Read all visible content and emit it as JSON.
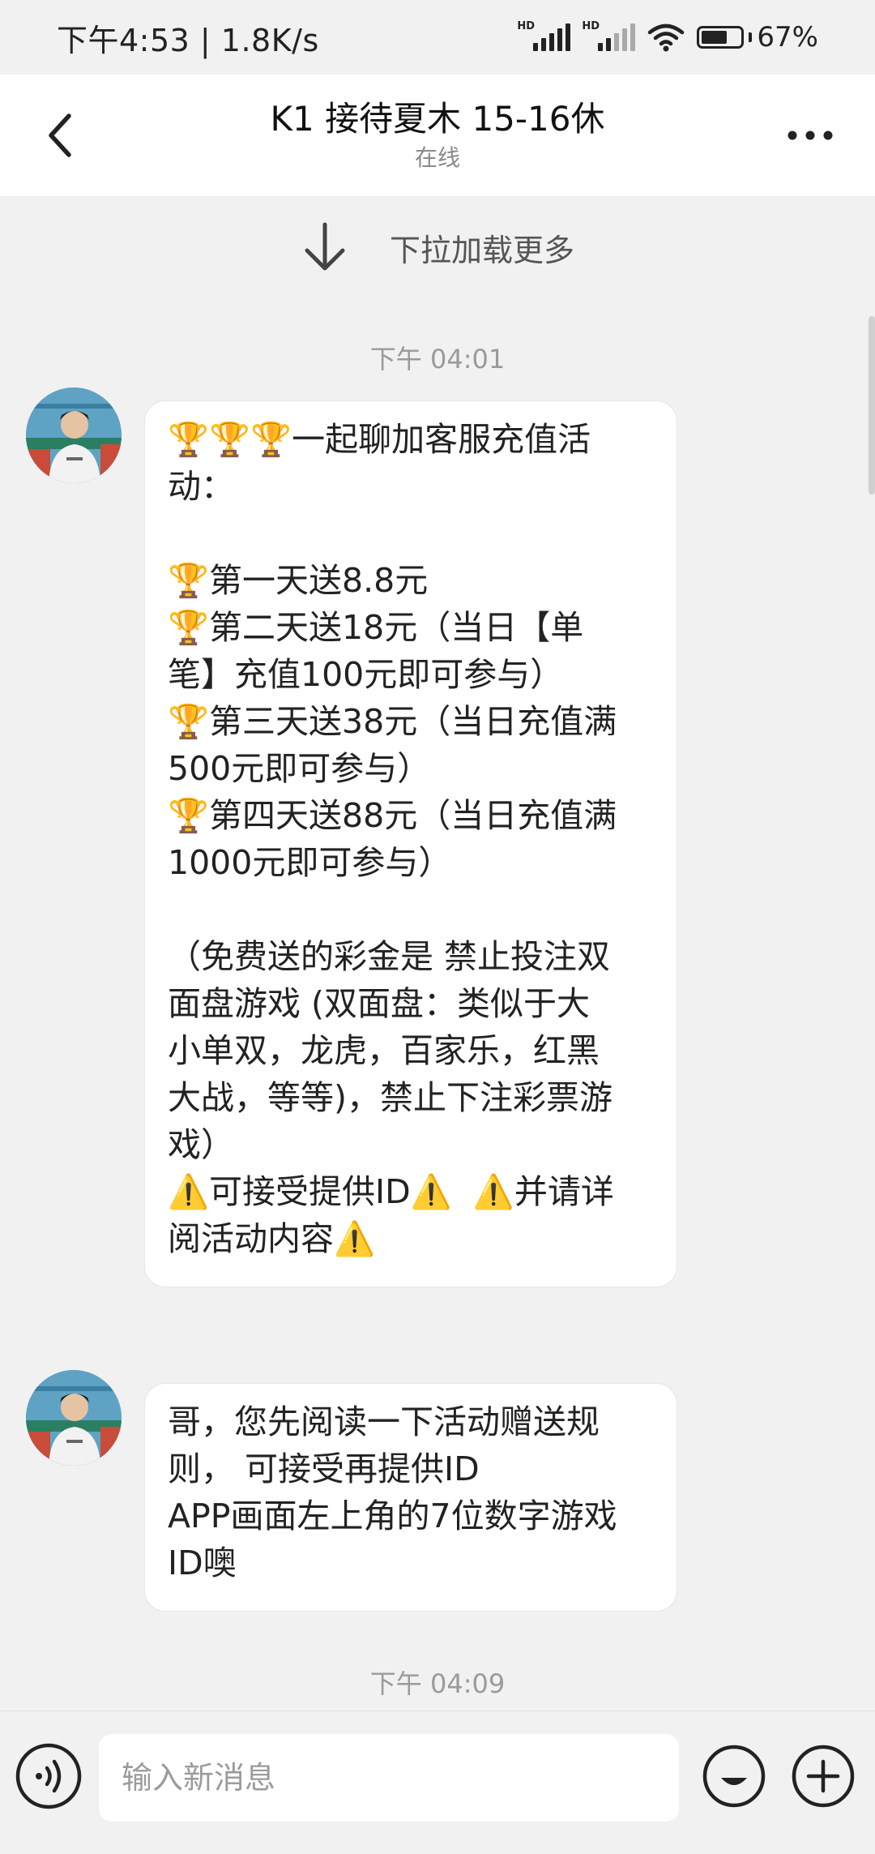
{
  "status_bar": {
    "time_speed": "下午4:53 | 1.8K/s",
    "signal1_label": "HD",
    "signal2_label": "HD",
    "battery_text": "67%",
    "battery_level": 0.67
  },
  "header": {
    "title": "K1 接待夏木 15-16休",
    "subtitle": "在线"
  },
  "pull_to_load": "下拉加载更多",
  "messages": [
    {
      "timestamp": "下午 04:01",
      "lines": [
        "🏆🏆🏆一起聊加客服充值活",
        "动：",
        "",
        "🏆第一天送8.8元",
        "🏆第二天送18元（当日【单",
        "笔】充值100元即可参与）",
        "🏆第三天送38元（当日充值满",
        "500元即可参与）",
        "🏆第四天送88元（当日充值满",
        "1000元即可参与）",
        "",
        "（免费送的彩金是 禁止投注双",
        "面盘游戏 (双面盘：类似于大",
        "小单双，龙虎，百家乐，红黑",
        "大战，等等)，禁止下注彩票游",
        "戏）",
        "⚠️可接受提供ID⚠️  ⚠️并请详",
        "阅活动内容⚠️"
      ]
    },
    {
      "lines": [
        "哥，您先阅读一下活动赠送规",
        "则， 可接受再提供ID",
        "APP画面左上角的7位数字游戏",
        "ID噢"
      ]
    },
    {
      "timestamp": "下午 04:09"
    }
  ],
  "input": {
    "placeholder": "输入新消息"
  },
  "icons": {
    "back": "chevron-left-icon",
    "more": "more-horizontal-icon",
    "pull": "arrow-down-icon",
    "voice": "voice-icon",
    "emoji": "emoji-icon",
    "plus": "plus-icon"
  }
}
